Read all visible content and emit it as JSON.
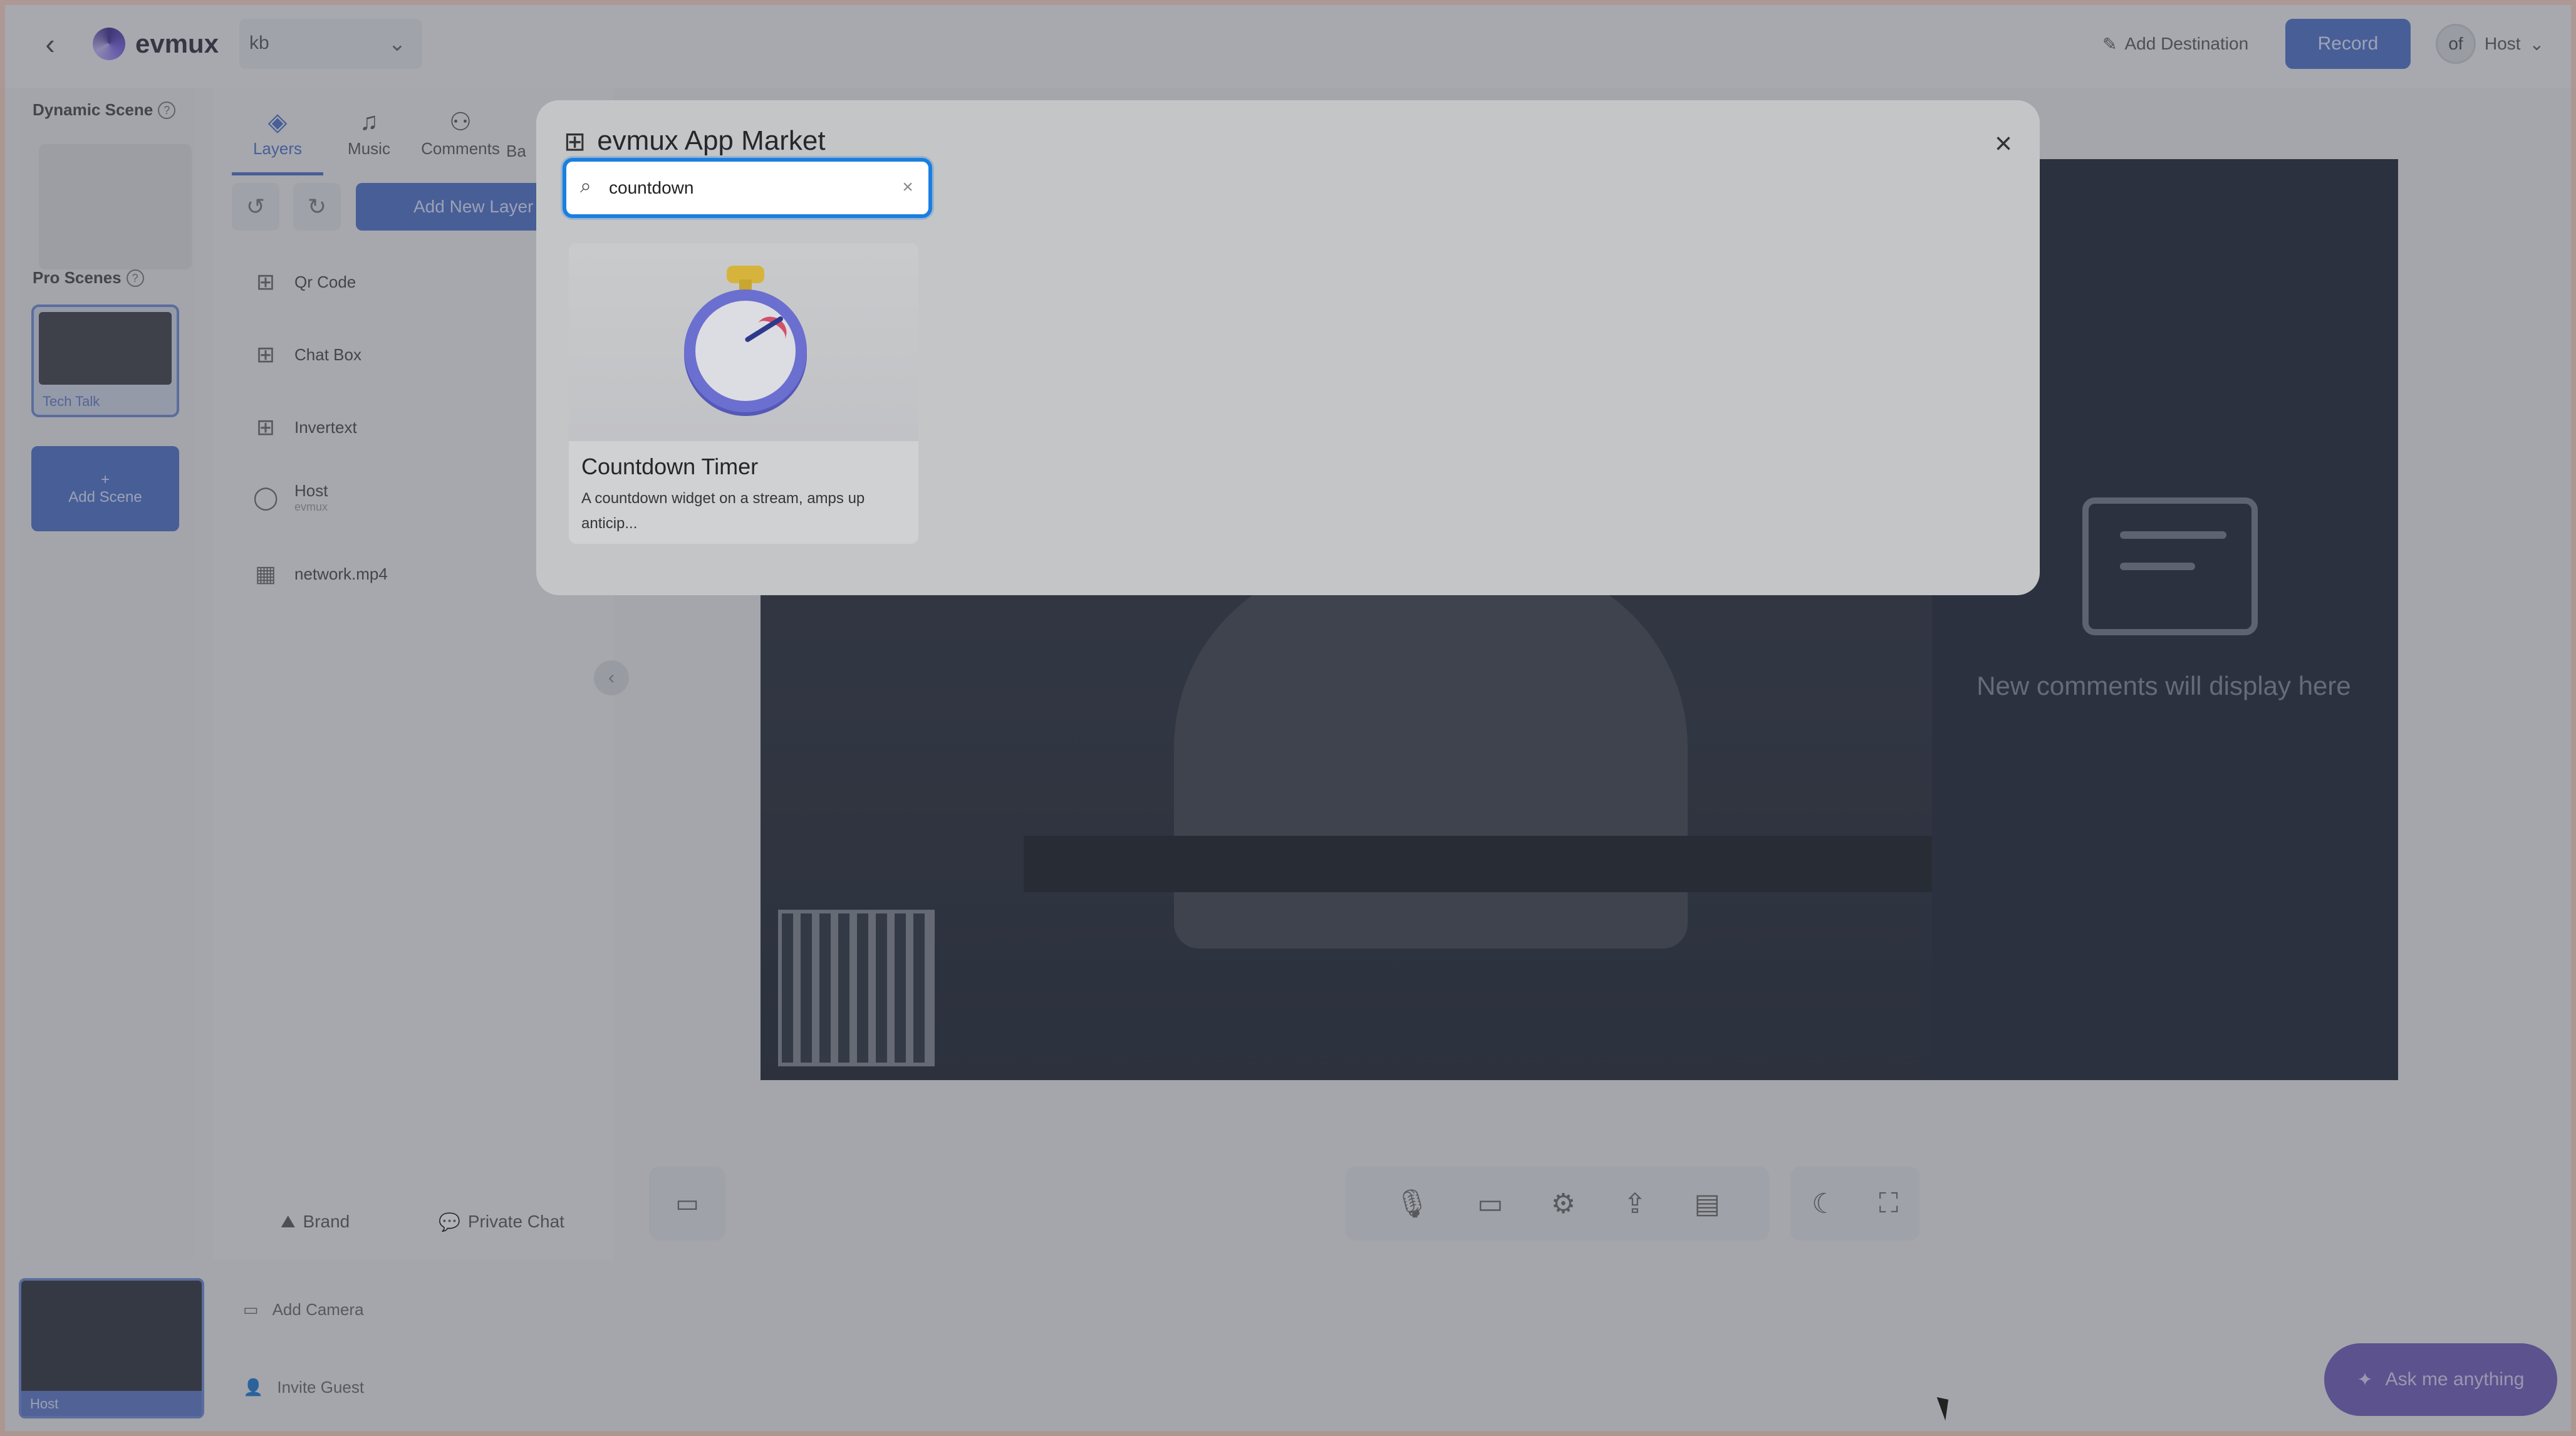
{
  "header": {
    "back_icon": "chevron-left-icon",
    "app_name": "evmux",
    "workspace_value": "kb",
    "add_destination_label": "Add Destination",
    "record_label": "Record",
    "host_avatar_initials": "of",
    "host_label": "Host"
  },
  "scenes": {
    "dynamic_label": "Dynamic Scene",
    "pro_label": "Pro Scenes",
    "pro_items": [
      {
        "label": "Tech Talk"
      }
    ],
    "add_scene_label": "Add Scene"
  },
  "layers_panel": {
    "tabs": [
      {
        "label": "Layers",
        "icon": "layers-icon",
        "active": true
      },
      {
        "label": "Music",
        "icon": "music-icon"
      },
      {
        "label": "Comments",
        "icon": "comments-icon"
      },
      {
        "label": "Ba"
      }
    ],
    "add_layer_label": "Add New Layer",
    "items": [
      {
        "label": "Qr Code",
        "icon": "grid-icon"
      },
      {
        "label": "Chat Box",
        "icon": "grid-icon"
      },
      {
        "label": "Invertext",
        "icon": "grid-icon"
      },
      {
        "label": "Host",
        "sublabel": "evmux",
        "icon": "user-icon"
      },
      {
        "label": "network.mp4",
        "icon": "video-icon"
      }
    ],
    "footer": {
      "brand_label": "Brand",
      "private_chat_label": "Private Chat"
    }
  },
  "stage": {
    "comments_placeholder": "New comments will display here"
  },
  "bottom": {
    "guest_label": "Host",
    "add_camera_label": "Add Camera",
    "invite_guest_label": "Invite Guest",
    "ask_label": "Ask me anything"
  },
  "app_market": {
    "title": "evmux App Market",
    "search_value": "countdown",
    "results": [
      {
        "name": "Countdown Timer",
        "description": "A countdown widget on a stream, amps up anticip..."
      }
    ]
  },
  "colors": {
    "accent": "#4b6ec9",
    "focus": "#1a7fe0",
    "ask_button": "#6d5bb8"
  }
}
